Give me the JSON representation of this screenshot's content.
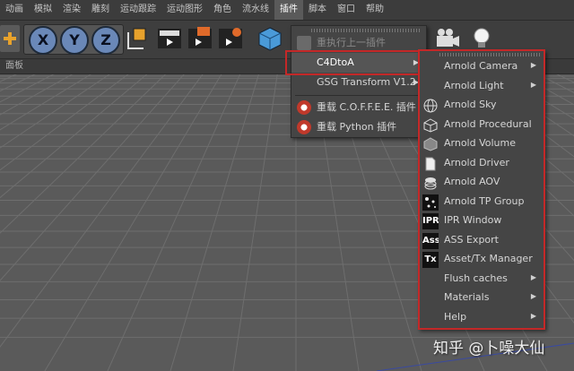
{
  "menubar": {
    "items": [
      "动画",
      "模拟",
      "渲染",
      "雕刻",
      "运动跟踪",
      "运动图形",
      "角色",
      "流水线",
      "插件",
      "脚本",
      "窗口",
      "帮助"
    ],
    "active_index": 8
  },
  "toolbar": {
    "axes": [
      "X",
      "Y",
      "Z"
    ]
  },
  "panel_label": "面板",
  "plugins_menu": {
    "items": [
      {
        "label": "重执行上一插件",
        "disabled": true,
        "icon": "plugin-icon"
      },
      {
        "label": "C4DtoA",
        "submenu": true,
        "highlighted": true
      },
      {
        "label": "GSG Transform V1.2",
        "submenu": true
      },
      {
        "label": "重载 C.O.F.F.E.E. 插件",
        "icon": "reload-icon"
      },
      {
        "label": "重载 Python 插件",
        "icon": "python-icon"
      }
    ]
  },
  "c4dtoa_menu": {
    "items": [
      {
        "label": "Arnold Camera",
        "submenu": true,
        "icon": ""
      },
      {
        "label": "Arnold Light",
        "submenu": true,
        "icon": ""
      },
      {
        "label": "Arnold Sky",
        "submenu": false,
        "icon": "sphere-grid-icon"
      },
      {
        "label": "Arnold Procedural",
        "submenu": false,
        "icon": "cube-wire-icon"
      },
      {
        "label": "Arnold Volume",
        "submenu": false,
        "icon": "cube-solid-icon"
      },
      {
        "label": "Arnold Driver",
        "submenu": false,
        "icon": "document-icon"
      },
      {
        "label": "Arnold AOV",
        "submenu": false,
        "icon": "layers-icon"
      },
      {
        "label": "Arnold TP Group",
        "submenu": false,
        "icon": "particles-icon"
      },
      {
        "label": "IPR Window",
        "submenu": false,
        "icon": "ipr-icon",
        "badge": "IPR"
      },
      {
        "label": "ASS Export",
        "submenu": false,
        "icon": "ass-icon",
        "badge": "Ass"
      },
      {
        "label": "Asset/Tx Manager",
        "submenu": false,
        "icon": "tx-icon",
        "badge": "Tx"
      },
      {
        "label": "Flush caches",
        "submenu": true,
        "icon": ""
      },
      {
        "label": "Materials",
        "submenu": true,
        "icon": ""
      },
      {
        "label": "Help",
        "submenu": true,
        "icon": ""
      }
    ]
  },
  "watermark": "知乎 @卜噪大仙",
  "colors": {
    "highlight_border": "#c42828",
    "menu_bg": "#454545",
    "viewport_bg": "#5a5a5a"
  }
}
